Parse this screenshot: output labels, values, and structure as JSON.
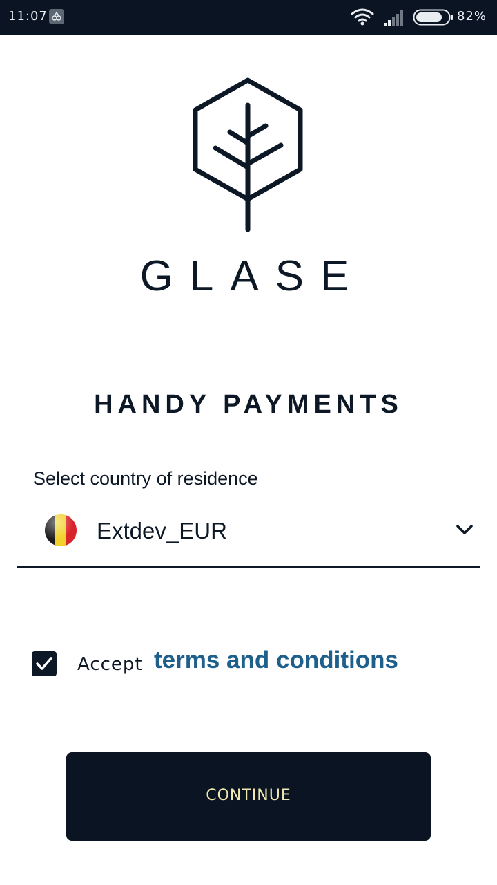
{
  "status_bar": {
    "time": "11:07",
    "battery_percent": "82%",
    "battery_level": 0.82,
    "icons": [
      "app-notification-icon",
      "wifi-icon",
      "cell-signal-icon",
      "battery-icon"
    ]
  },
  "brand": {
    "name": "GLASE",
    "logo_icon": "tree-hexagon-logo"
  },
  "tagline": "HANDY PAYMENTS",
  "country_select": {
    "label": "Select country of residence",
    "selected_value": "Extdev_EUR",
    "flag_icon": "belgium-flag-icon",
    "flag_colors": [
      "#1b1b1b",
      "#f2d22a",
      "#d8242b"
    ]
  },
  "terms": {
    "checked": true,
    "accept_text": "Accept",
    "link_text": "terms and conditions"
  },
  "continue_button": {
    "label": "CONTINUE"
  },
  "colors": {
    "dark_navy": "#0b1422",
    "link_blue": "#1e5f8c",
    "button_text": "#f1e7b0"
  }
}
